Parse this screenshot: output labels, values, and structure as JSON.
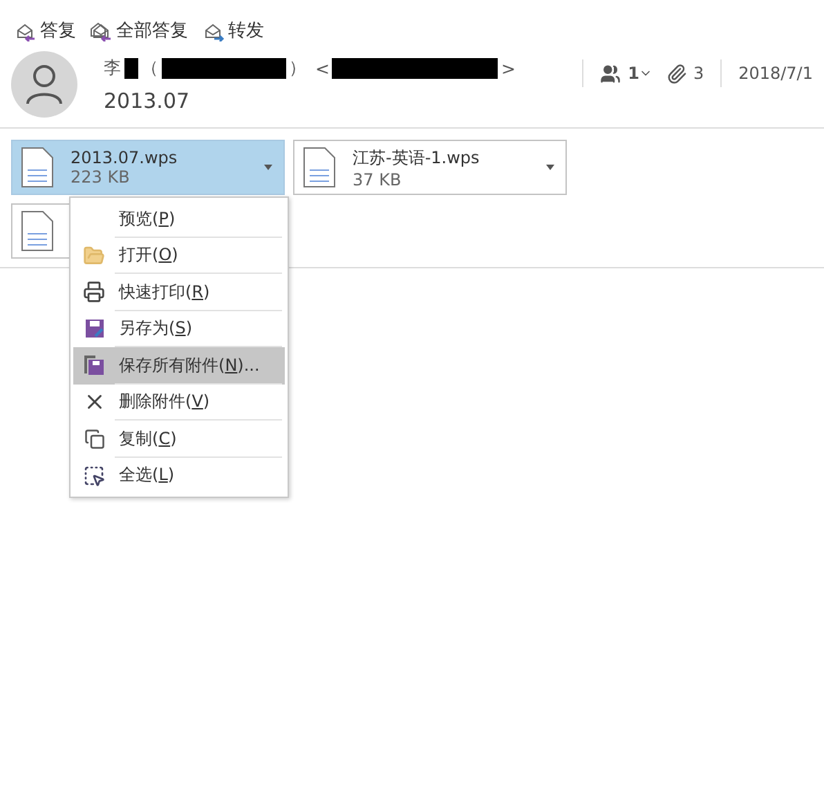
{
  "toolbar": [
    {
      "kind": "reply",
      "label": "答复"
    },
    {
      "kind": "reply_all",
      "label": "全部答复"
    },
    {
      "kind": "forward",
      "label": "转发"
    }
  ],
  "message": {
    "sender_parts": [
      "李",
      "（",
      "）",
      "<",
      ">"
    ],
    "subject": "2013.07",
    "recipients_count": "1",
    "attachments_count": "3",
    "date": "2018/7/1"
  },
  "attachments": [
    {
      "name": "2013.07.wps",
      "size": "223 KB",
      "selected": true
    },
    {
      "name": "江苏-英语-1.wps",
      "size": "37 KB",
      "selected": false
    },
    {
      "selected": false
    }
  ],
  "context_menu": [
    {
      "kind": "none",
      "before": "预览(",
      "key": "P",
      "after": ")",
      "selected": false
    },
    {
      "kind": "folder",
      "before": "打开(",
      "key": "O",
      "after": ")",
      "selected": false
    },
    {
      "kind": "printer",
      "before": "快速打印(",
      "key": "R",
      "after": ")",
      "selected": false
    },
    {
      "kind": "save_as",
      "before": "另存为(",
      "key": "S",
      "after": ")",
      "selected": false
    },
    {
      "kind": "save_all",
      "before": "保存所有附件(",
      "key": "N",
      "after": ")...",
      "selected": true
    },
    {
      "kind": "delete",
      "before": "删除附件(",
      "key": "V",
      "after": ")",
      "selected": false
    },
    {
      "kind": "copy",
      "before": "复制(",
      "key": "C",
      "after": ")",
      "selected": false
    },
    {
      "kind": "select_all",
      "before": "全选(",
      "key": "L",
      "after": ")",
      "selected": false
    }
  ]
}
